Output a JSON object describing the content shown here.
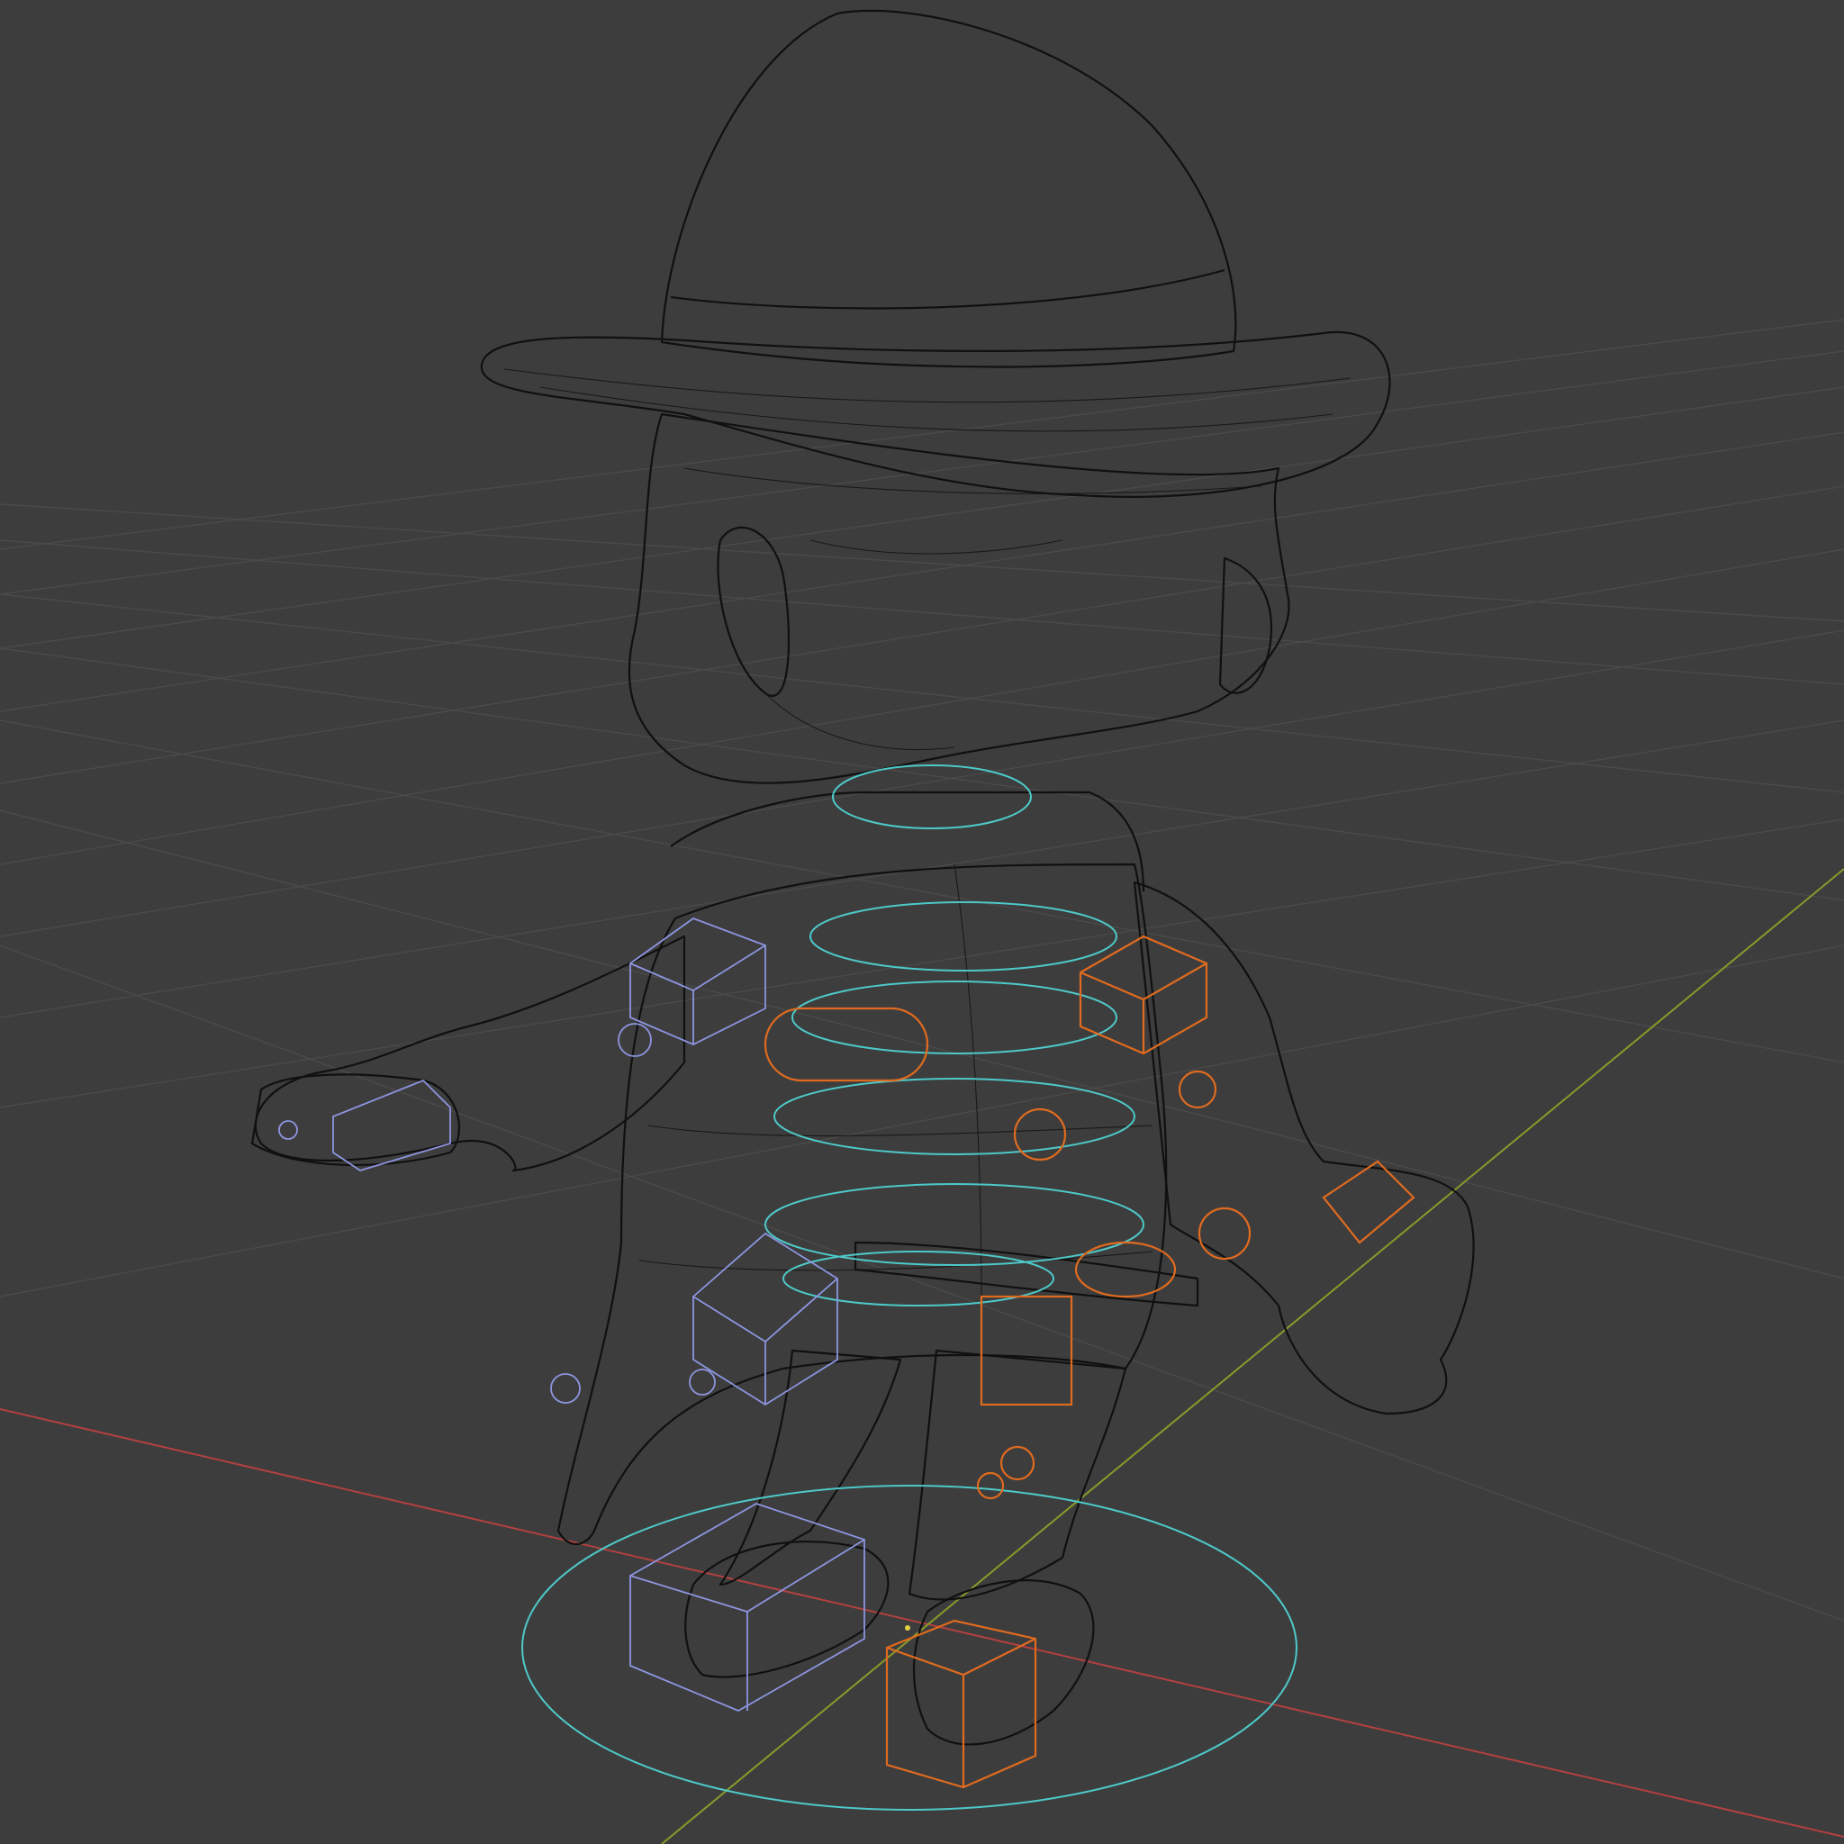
{
  "viewport": {
    "name": "3D Viewport",
    "mode": "wireframe",
    "background": "#3d3d3d",
    "grid_color": "#4a4a4a",
    "axis_x_color": "#b34040",
    "axis_y_color": "#8a9a2a"
  },
  "scene": {
    "objects": [
      {
        "name": "character-mesh",
        "shading": "wireframe",
        "color": "#101010"
      },
      {
        "name": "rig-controls-center",
        "color": "#4ec9c9"
      },
      {
        "name": "rig-controls-left",
        "color": "#e06b1f"
      },
      {
        "name": "rig-controls-right",
        "color": "#8d95e0"
      }
    ]
  }
}
